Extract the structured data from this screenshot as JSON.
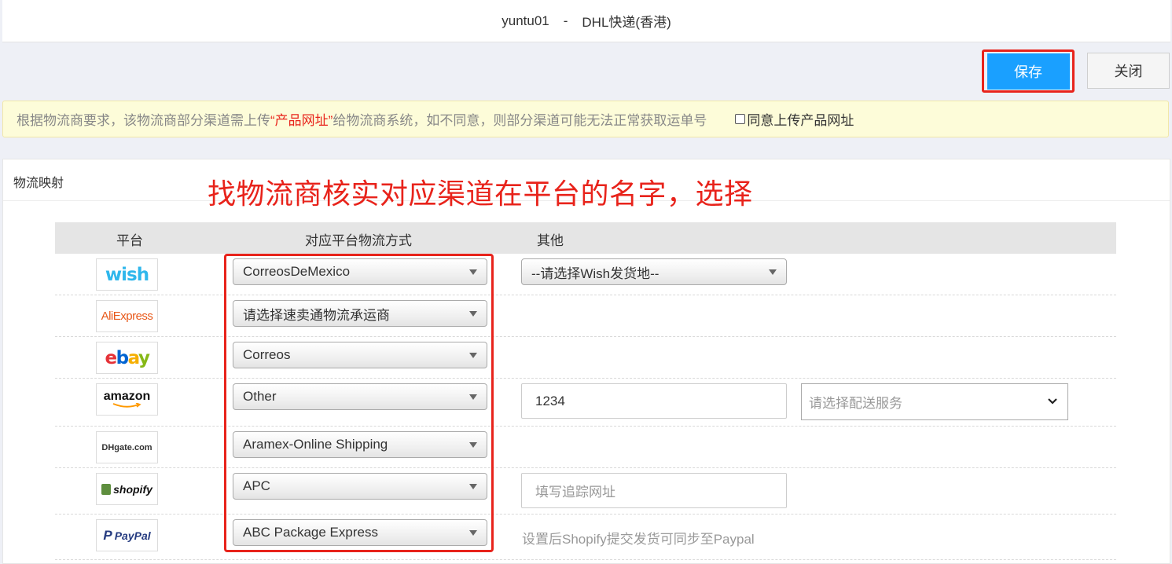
{
  "title": {
    "account": "yuntu01",
    "separator": "-",
    "channel": "DHL快递(香港)"
  },
  "toolbar": {
    "save_label": "保存",
    "close_label": "关闭"
  },
  "notice": {
    "text_before": "根据物流商要求，该物流商部分渠道需上传",
    "highlight": "“产品网址”",
    "text_after": "给物流商系统，如不同意，则部分渠道可能无法正常获取运单号",
    "agree_label": "同意上传产品网址"
  },
  "panel": {
    "title": "物流映射"
  },
  "annotation": "找物流商核实对应渠道在平台的名字，选择",
  "table": {
    "headers": {
      "platform": "平台",
      "method": "对应平台物流方式",
      "other": "其他"
    },
    "rows": [
      {
        "platform": "wish",
        "method": "CorreosDeMexico",
        "other_select": "--请选择Wish发货地--"
      },
      {
        "platform": "AliExpress",
        "method": "请选择速卖通物流承运商"
      },
      {
        "platform": "ebay",
        "method": "Correos"
      },
      {
        "platform": "amazon",
        "method": "Other",
        "other_input": "1234",
        "other_dropdown_placeholder": "请选择配送服务"
      },
      {
        "platform": "DHgate.com",
        "method": "Aramex-Online Shipping"
      },
      {
        "platform": "shopify",
        "method": "APC",
        "other_input_placeholder": "填写追踪网址"
      },
      {
        "platform": "PayPal",
        "method": "ABC Package Express",
        "other_hint": "设置后Shopify提交发货可同步至Paypal"
      }
    ]
  },
  "colors": {
    "accent": "#1aa0ff",
    "annotation_red": "#e8231b",
    "notice_bg": "#fdfcd9"
  }
}
